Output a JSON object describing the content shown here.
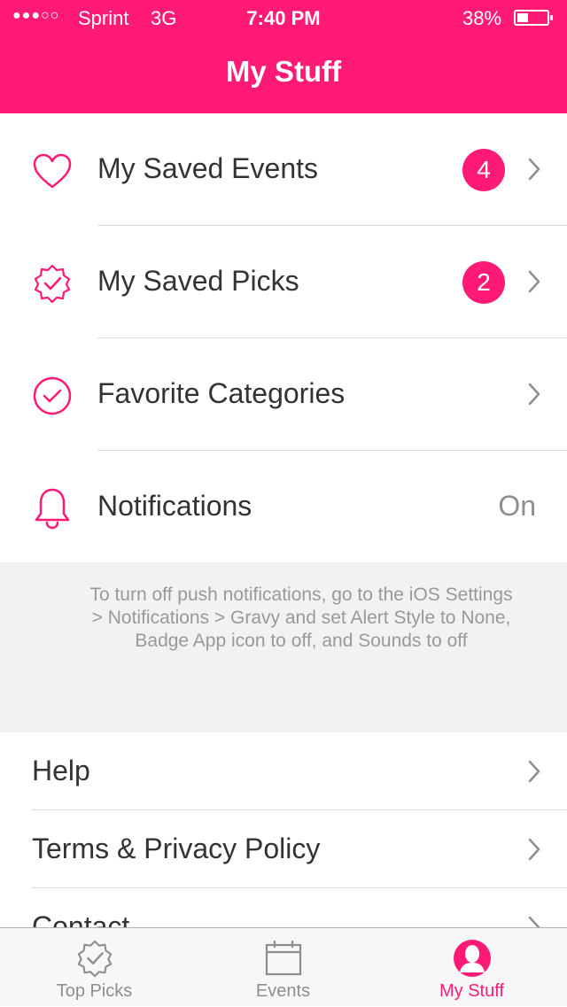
{
  "status_bar": {
    "signal": "●●●○○",
    "carrier": "Sprint",
    "network": "3G",
    "time": "7:40 PM",
    "battery_percent": "38%",
    "battery_level": 0.38
  },
  "nav": {
    "title": "My Stuff"
  },
  "accent_color": "#ff1a75",
  "menu": {
    "items": [
      {
        "label": "My Saved Events",
        "icon": "heart-icon",
        "badge": "4"
      },
      {
        "label": "My Saved Picks",
        "icon": "badge-check-icon",
        "badge": "2"
      },
      {
        "label": "Favorite Categories",
        "icon": "circle-check-icon"
      },
      {
        "label": "Notifications",
        "icon": "bell-icon",
        "value": "On"
      }
    ]
  },
  "info": {
    "text": "To turn off push notifications, go to the iOS Settings > Notifications > Gravy and set Alert Style to None, Badge App icon to off, and Sounds to off"
  },
  "bottom_menu": {
    "items": [
      {
        "label": "Help"
      },
      {
        "label": "Terms & Privacy Policy"
      },
      {
        "label": "Contact"
      }
    ]
  },
  "tabs": [
    {
      "label": "Top Picks",
      "icon": "badge-check-icon",
      "active": false
    },
    {
      "label": "Events",
      "icon": "calendar-icon",
      "active": false
    },
    {
      "label": "My Stuff",
      "icon": "person-icon",
      "active": true
    }
  ]
}
